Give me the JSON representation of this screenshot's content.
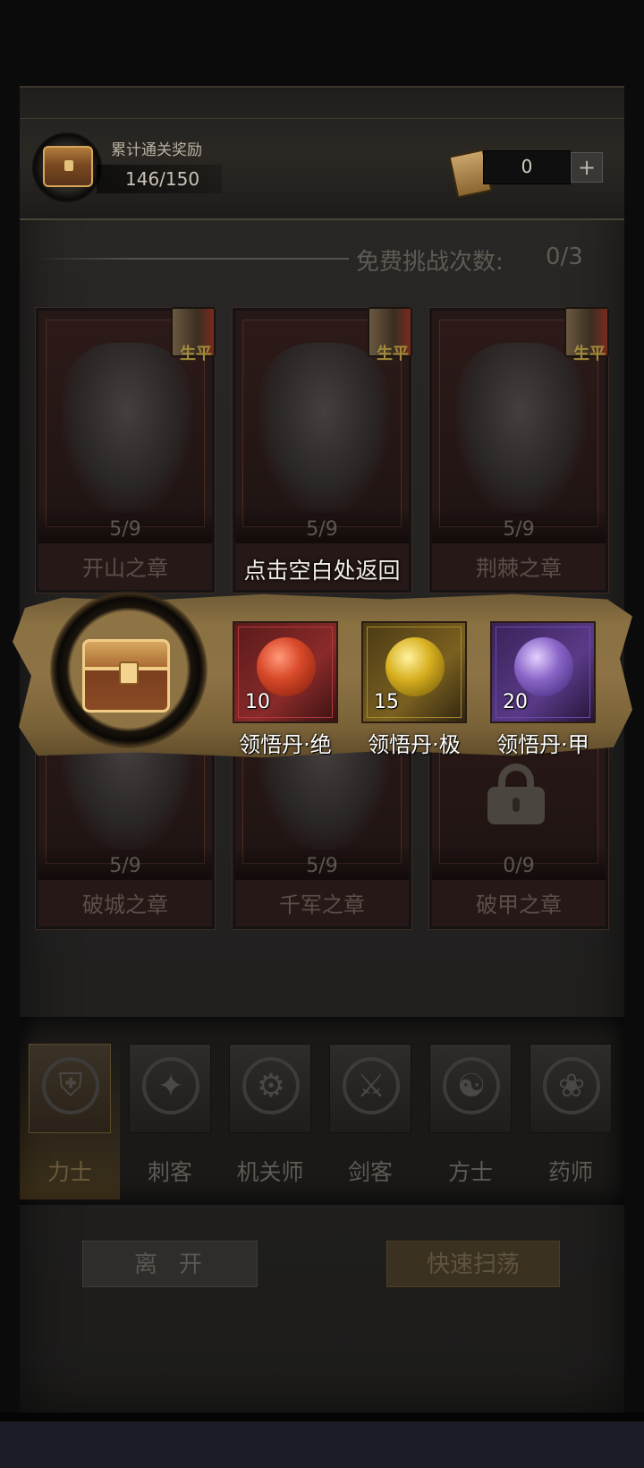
{
  "header": {
    "reward_title": "累计通关奖励",
    "reward_progress": "146/150",
    "ticket_count": "0",
    "plus_label": "+"
  },
  "free_challenge": {
    "label": "免费挑战次数:",
    "value": "0/3"
  },
  "book_badge": "生平",
  "chapters": [
    {
      "progress": "5/9",
      "name": "开山之章"
    },
    {
      "progress": "5/9",
      "name": ""
    },
    {
      "progress": "5/9",
      "name": "荆棘之章"
    },
    {
      "progress": "5/9",
      "name": "破城之章"
    },
    {
      "progress": "5/9",
      "name": "千军之章"
    },
    {
      "progress": "0/9",
      "name": "破甲之章"
    }
  ],
  "overlay": {
    "back_hint": "点击空白处返回",
    "items": [
      {
        "qty": "10",
        "name": "领悟丹·绝",
        "color": "#d94a2a",
        "frame": "#b23a3a"
      },
      {
        "qty": "15",
        "name": "领悟丹·极",
        "color": "#d8b020",
        "frame": "#a88a2a"
      },
      {
        "qty": "20",
        "name": "领悟丹·甲",
        "color": "#8a66c8",
        "frame": "#6a4aa8"
      }
    ]
  },
  "tabs": [
    {
      "label": "力士",
      "icon": "shield-icon",
      "glyph": "⛨"
    },
    {
      "label": "刺客",
      "icon": "blade-icon",
      "glyph": "✦"
    },
    {
      "label": "机关师",
      "icon": "gear-icon",
      "glyph": "⚙"
    },
    {
      "label": "剑客",
      "icon": "sword-icon",
      "glyph": "⚔"
    },
    {
      "label": "方士",
      "icon": "yin-yang-icon",
      "glyph": "☯"
    },
    {
      "label": "药师",
      "icon": "gourd-icon",
      "glyph": "❀"
    }
  ],
  "buttons": {
    "leave": "离开",
    "sweep": "快速扫荡"
  }
}
